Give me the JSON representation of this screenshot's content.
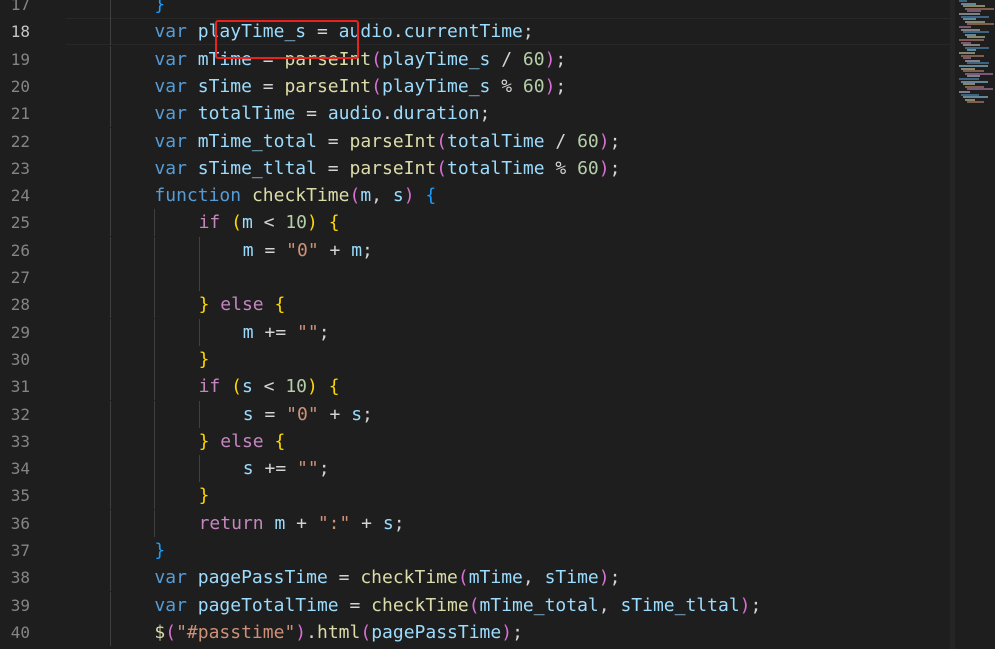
{
  "editor": {
    "current_line": 18,
    "highlight_color": "#e8231d",
    "lines": [
      {
        "num": "17",
        "indent": 2,
        "tokens": [
          {
            "t": "}",
            "c": "b3"
          }
        ]
      },
      {
        "num": "18",
        "indent": 2,
        "tokens": [
          {
            "t": "var",
            "c": "kw"
          },
          {
            "t": " ",
            "c": "p"
          },
          {
            "t": "playTime_s",
            "c": "var"
          },
          {
            "t": " = ",
            "c": "p"
          },
          {
            "t": "audio",
            "c": "var"
          },
          {
            "t": ".",
            "c": "p"
          },
          {
            "t": "currentTime",
            "c": "var"
          },
          {
            "t": ";",
            "c": "p"
          }
        ]
      },
      {
        "num": "19",
        "indent": 2,
        "tokens": [
          {
            "t": "var",
            "c": "kw"
          },
          {
            "t": " ",
            "c": "p"
          },
          {
            "t": "mTime",
            "c": "var"
          },
          {
            "t": " = ",
            "c": "p"
          },
          {
            "t": "parseInt",
            "c": "fn"
          },
          {
            "t": "(",
            "c": "b2"
          },
          {
            "t": "playTime_s",
            "c": "var"
          },
          {
            "t": " / ",
            "c": "p"
          },
          {
            "t": "60",
            "c": "num"
          },
          {
            "t": ")",
            "c": "b2"
          },
          {
            "t": ";",
            "c": "p"
          }
        ]
      },
      {
        "num": "20",
        "indent": 2,
        "tokens": [
          {
            "t": "var",
            "c": "kw"
          },
          {
            "t": " ",
            "c": "p"
          },
          {
            "t": "sTime",
            "c": "var"
          },
          {
            "t": " = ",
            "c": "p"
          },
          {
            "t": "parseInt",
            "c": "fn"
          },
          {
            "t": "(",
            "c": "b2"
          },
          {
            "t": "playTime_s",
            "c": "var"
          },
          {
            "t": " % ",
            "c": "p"
          },
          {
            "t": "60",
            "c": "num"
          },
          {
            "t": ")",
            "c": "b2"
          },
          {
            "t": ";",
            "c": "p"
          }
        ]
      },
      {
        "num": "21",
        "indent": 2,
        "tokens": [
          {
            "t": "var",
            "c": "kw"
          },
          {
            "t": " ",
            "c": "p"
          },
          {
            "t": "totalTime",
            "c": "var"
          },
          {
            "t": " = ",
            "c": "p"
          },
          {
            "t": "audio",
            "c": "var"
          },
          {
            "t": ".",
            "c": "p"
          },
          {
            "t": "duration",
            "c": "var"
          },
          {
            "t": ";",
            "c": "p"
          }
        ]
      },
      {
        "num": "22",
        "indent": 2,
        "tokens": [
          {
            "t": "var",
            "c": "kw"
          },
          {
            "t": " ",
            "c": "p"
          },
          {
            "t": "mTime_total",
            "c": "var"
          },
          {
            "t": " = ",
            "c": "p"
          },
          {
            "t": "parseInt",
            "c": "fn"
          },
          {
            "t": "(",
            "c": "b2"
          },
          {
            "t": "totalTime",
            "c": "var"
          },
          {
            "t": " / ",
            "c": "p"
          },
          {
            "t": "60",
            "c": "num"
          },
          {
            "t": ")",
            "c": "b2"
          },
          {
            "t": ";",
            "c": "p"
          }
        ]
      },
      {
        "num": "23",
        "indent": 2,
        "tokens": [
          {
            "t": "var",
            "c": "kw"
          },
          {
            "t": " ",
            "c": "p"
          },
          {
            "t": "sTime_tltal",
            "c": "var"
          },
          {
            "t": " = ",
            "c": "p"
          },
          {
            "t": "parseInt",
            "c": "fn"
          },
          {
            "t": "(",
            "c": "b2"
          },
          {
            "t": "totalTime",
            "c": "var"
          },
          {
            "t": " % ",
            "c": "p"
          },
          {
            "t": "60",
            "c": "num"
          },
          {
            "t": ")",
            "c": "b2"
          },
          {
            "t": ";",
            "c": "p"
          }
        ]
      },
      {
        "num": "24",
        "indent": 2,
        "tokens": [
          {
            "t": "function",
            "c": "kw"
          },
          {
            "t": " ",
            "c": "p"
          },
          {
            "t": "checkTime",
            "c": "fn"
          },
          {
            "t": "(",
            "c": "b2"
          },
          {
            "t": "m",
            "c": "var"
          },
          {
            "t": ", ",
            "c": "p"
          },
          {
            "t": "s",
            "c": "var"
          },
          {
            "t": ")",
            "c": "b2"
          },
          {
            "t": " ",
            "c": "p"
          },
          {
            "t": "{",
            "c": "b3"
          }
        ]
      },
      {
        "num": "25",
        "indent": 3,
        "tokens": [
          {
            "t": "if",
            "c": "ctrl"
          },
          {
            "t": " ",
            "c": "p"
          },
          {
            "t": "(",
            "c": "b1"
          },
          {
            "t": "m",
            "c": "var"
          },
          {
            "t": " < ",
            "c": "p"
          },
          {
            "t": "10",
            "c": "num"
          },
          {
            "t": ")",
            "c": "b1"
          },
          {
            "t": " ",
            "c": "p"
          },
          {
            "t": "{",
            "c": "b1"
          }
        ]
      },
      {
        "num": "26",
        "indent": 4,
        "tokens": [
          {
            "t": "m",
            "c": "var"
          },
          {
            "t": " = ",
            "c": "p"
          },
          {
            "t": "\"0\"",
            "c": "str"
          },
          {
            "t": " + ",
            "c": "p"
          },
          {
            "t": "m",
            "c": "var"
          },
          {
            "t": ";",
            "c": "p"
          }
        ]
      },
      {
        "num": "27",
        "indent": 4,
        "tokens": []
      },
      {
        "num": "28",
        "indent": 3,
        "tokens": [
          {
            "t": "}",
            "c": "b1"
          },
          {
            "t": " ",
            "c": "p"
          },
          {
            "t": "else",
            "c": "ctrl"
          },
          {
            "t": " ",
            "c": "p"
          },
          {
            "t": "{",
            "c": "b1"
          }
        ]
      },
      {
        "num": "29",
        "indent": 4,
        "tokens": [
          {
            "t": "m",
            "c": "var"
          },
          {
            "t": " += ",
            "c": "p"
          },
          {
            "t": "\"\"",
            "c": "str"
          },
          {
            "t": ";",
            "c": "p"
          }
        ]
      },
      {
        "num": "30",
        "indent": 3,
        "tokens": [
          {
            "t": "}",
            "c": "b1"
          }
        ]
      },
      {
        "num": "31",
        "indent": 3,
        "tokens": [
          {
            "t": "if",
            "c": "ctrl"
          },
          {
            "t": " ",
            "c": "p"
          },
          {
            "t": "(",
            "c": "b1"
          },
          {
            "t": "s",
            "c": "var"
          },
          {
            "t": " < ",
            "c": "p"
          },
          {
            "t": "10",
            "c": "num"
          },
          {
            "t": ")",
            "c": "b1"
          },
          {
            "t": " ",
            "c": "p"
          },
          {
            "t": "{",
            "c": "b1"
          }
        ]
      },
      {
        "num": "32",
        "indent": 4,
        "tokens": [
          {
            "t": "s",
            "c": "var"
          },
          {
            "t": " = ",
            "c": "p"
          },
          {
            "t": "\"0\"",
            "c": "str"
          },
          {
            "t": " + ",
            "c": "p"
          },
          {
            "t": "s",
            "c": "var"
          },
          {
            "t": ";",
            "c": "p"
          }
        ]
      },
      {
        "num": "33",
        "indent": 3,
        "tokens": [
          {
            "t": "}",
            "c": "b1"
          },
          {
            "t": " ",
            "c": "p"
          },
          {
            "t": "else",
            "c": "ctrl"
          },
          {
            "t": " ",
            "c": "p"
          },
          {
            "t": "{",
            "c": "b1"
          }
        ]
      },
      {
        "num": "34",
        "indent": 4,
        "tokens": [
          {
            "t": "s",
            "c": "var"
          },
          {
            "t": " += ",
            "c": "p"
          },
          {
            "t": "\"\"",
            "c": "str"
          },
          {
            "t": ";",
            "c": "p"
          }
        ]
      },
      {
        "num": "35",
        "indent": 3,
        "tokens": [
          {
            "t": "}",
            "c": "b1"
          }
        ]
      },
      {
        "num": "36",
        "indent": 3,
        "tokens": [
          {
            "t": "return",
            "c": "ctrl"
          },
          {
            "t": " ",
            "c": "p"
          },
          {
            "t": "m",
            "c": "var"
          },
          {
            "t": " + ",
            "c": "p"
          },
          {
            "t": "\":\"",
            "c": "str"
          },
          {
            "t": " + ",
            "c": "p"
          },
          {
            "t": "s",
            "c": "var"
          },
          {
            "t": ";",
            "c": "p"
          }
        ]
      },
      {
        "num": "37",
        "indent": 2,
        "tokens": [
          {
            "t": "}",
            "c": "b3"
          }
        ]
      },
      {
        "num": "38",
        "indent": 2,
        "tokens": [
          {
            "t": "var",
            "c": "kw"
          },
          {
            "t": " ",
            "c": "p"
          },
          {
            "t": "pagePassTime",
            "c": "var"
          },
          {
            "t": " = ",
            "c": "p"
          },
          {
            "t": "checkTime",
            "c": "fn"
          },
          {
            "t": "(",
            "c": "b2"
          },
          {
            "t": "mTime",
            "c": "var"
          },
          {
            "t": ", ",
            "c": "p"
          },
          {
            "t": "sTime",
            "c": "var"
          },
          {
            "t": ")",
            "c": "b2"
          },
          {
            "t": ";",
            "c": "p"
          }
        ]
      },
      {
        "num": "39",
        "indent": 2,
        "tokens": [
          {
            "t": "var",
            "c": "kw"
          },
          {
            "t": " ",
            "c": "p"
          },
          {
            "t": "pageTotalTime",
            "c": "var"
          },
          {
            "t": " = ",
            "c": "p"
          },
          {
            "t": "checkTime",
            "c": "fn"
          },
          {
            "t": "(",
            "c": "b2"
          },
          {
            "t": "mTime_total",
            "c": "var"
          },
          {
            "t": ", ",
            "c": "p"
          },
          {
            "t": "sTime_tltal",
            "c": "var"
          },
          {
            "t": ")",
            "c": "b2"
          },
          {
            "t": ";",
            "c": "p"
          }
        ]
      },
      {
        "num": "40",
        "indent": 2,
        "tokens": [
          {
            "t": "$",
            "c": "fn"
          },
          {
            "t": "(",
            "c": "b2"
          },
          {
            "t": "\"#passtime\"",
            "c": "str"
          },
          {
            "t": ")",
            "c": "b2"
          },
          {
            "t": ".",
            "c": "p"
          },
          {
            "t": "html",
            "c": "fn"
          },
          {
            "t": "(",
            "c": "b2"
          },
          {
            "t": "pagePassTime",
            "c": "var"
          },
          {
            "t": ")",
            "c": "b2"
          },
          {
            "t": ";",
            "c": "p"
          }
        ]
      }
    ]
  }
}
